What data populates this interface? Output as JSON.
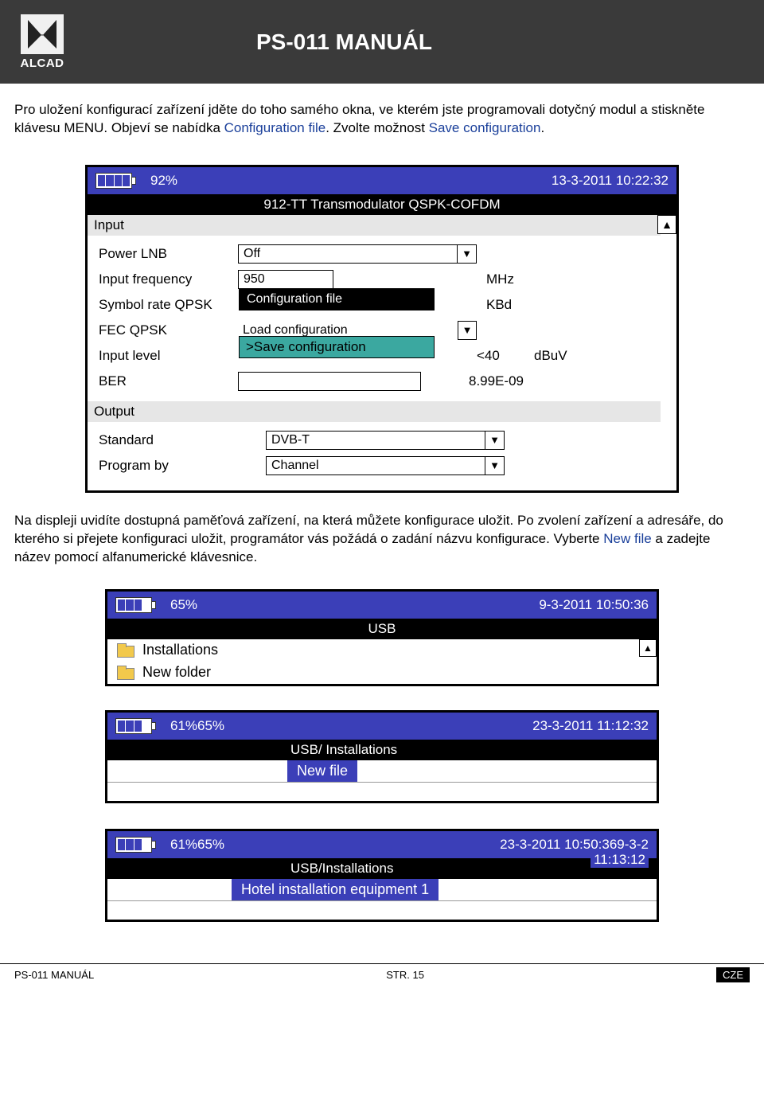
{
  "header": {
    "brand": "ALCAD",
    "title": "PS-011 MANUÁL"
  },
  "para1": {
    "t1": "Pro uložení konfigurací zařízení jděte do toho samého okna, ve kterém jste programovali dotyčný modul a stiskněte klávesu MENU. Objeví se nabídka ",
    "b1": "Configuration file",
    "t2": ". Zvolte možnost ",
    "b2": "Save configuration",
    "t3": "."
  },
  "screen1": {
    "battery_pct": "92%",
    "datetime": "13-3-2011 10:22:32",
    "device_title": "912-TT Transmodulator QSPK-COFDM",
    "section_input": "Input",
    "labels": {
      "power_lnb": "Power LNB",
      "input_freq": "Input frequency",
      "symbol_rate": "Symbol rate QPSK",
      "fec": "FEC QPSK",
      "input_level": "Input level",
      "ber": "BER",
      "standard": "Standard",
      "program_by": "Program by"
    },
    "values": {
      "power_lnb": "Off",
      "input_freq": "950",
      "input_freq_unit": "MHz",
      "symbol_rate_unit": "KBd",
      "fec": "Load configuration",
      "input_level_val": "<40",
      "input_level_unit": "dBuV",
      "ber": "8.99E-09",
      "standard": "DVB-T",
      "program_by": "Channel"
    },
    "overlay_black": "Configuration file",
    "overlay_teal": ">Save configuration",
    "section_output": "Output"
  },
  "para2": {
    "t1": "Na displeji uvidíte dostupná paměťová zařízení, na která můžete konfigurace uložit. Po zvolení zařízení a adresáře, do kterého si přejete konfiguraci uložit, programátor vás požádá o zadání názvu konfigurace. Vyberte ",
    "b1": "New file",
    "t2": " a zadejte název pomocí alfanumerické klávesnice."
  },
  "screen2": {
    "battery_pct": "65%",
    "datetime": "9-3-2011 10:50:36",
    "title": "USB",
    "items": [
      "Installations",
      "New folder"
    ]
  },
  "screen3": {
    "battery_pct": "61%65%",
    "datetime": "23-3-2011  11:12:32",
    "title": "USB/ Installations",
    "selected": "New file"
  },
  "screen4": {
    "battery_pct": "61%65%",
    "datetime1": "23-3-2011 10:50:369-3-2",
    "datetime2": "11:13:12",
    "title": "USB/Installations",
    "selected": "Hotel installation equipment 1"
  },
  "footer": {
    "left": "PS-011 MANUÁL",
    "center": "STR. 15",
    "right": "CZE"
  }
}
